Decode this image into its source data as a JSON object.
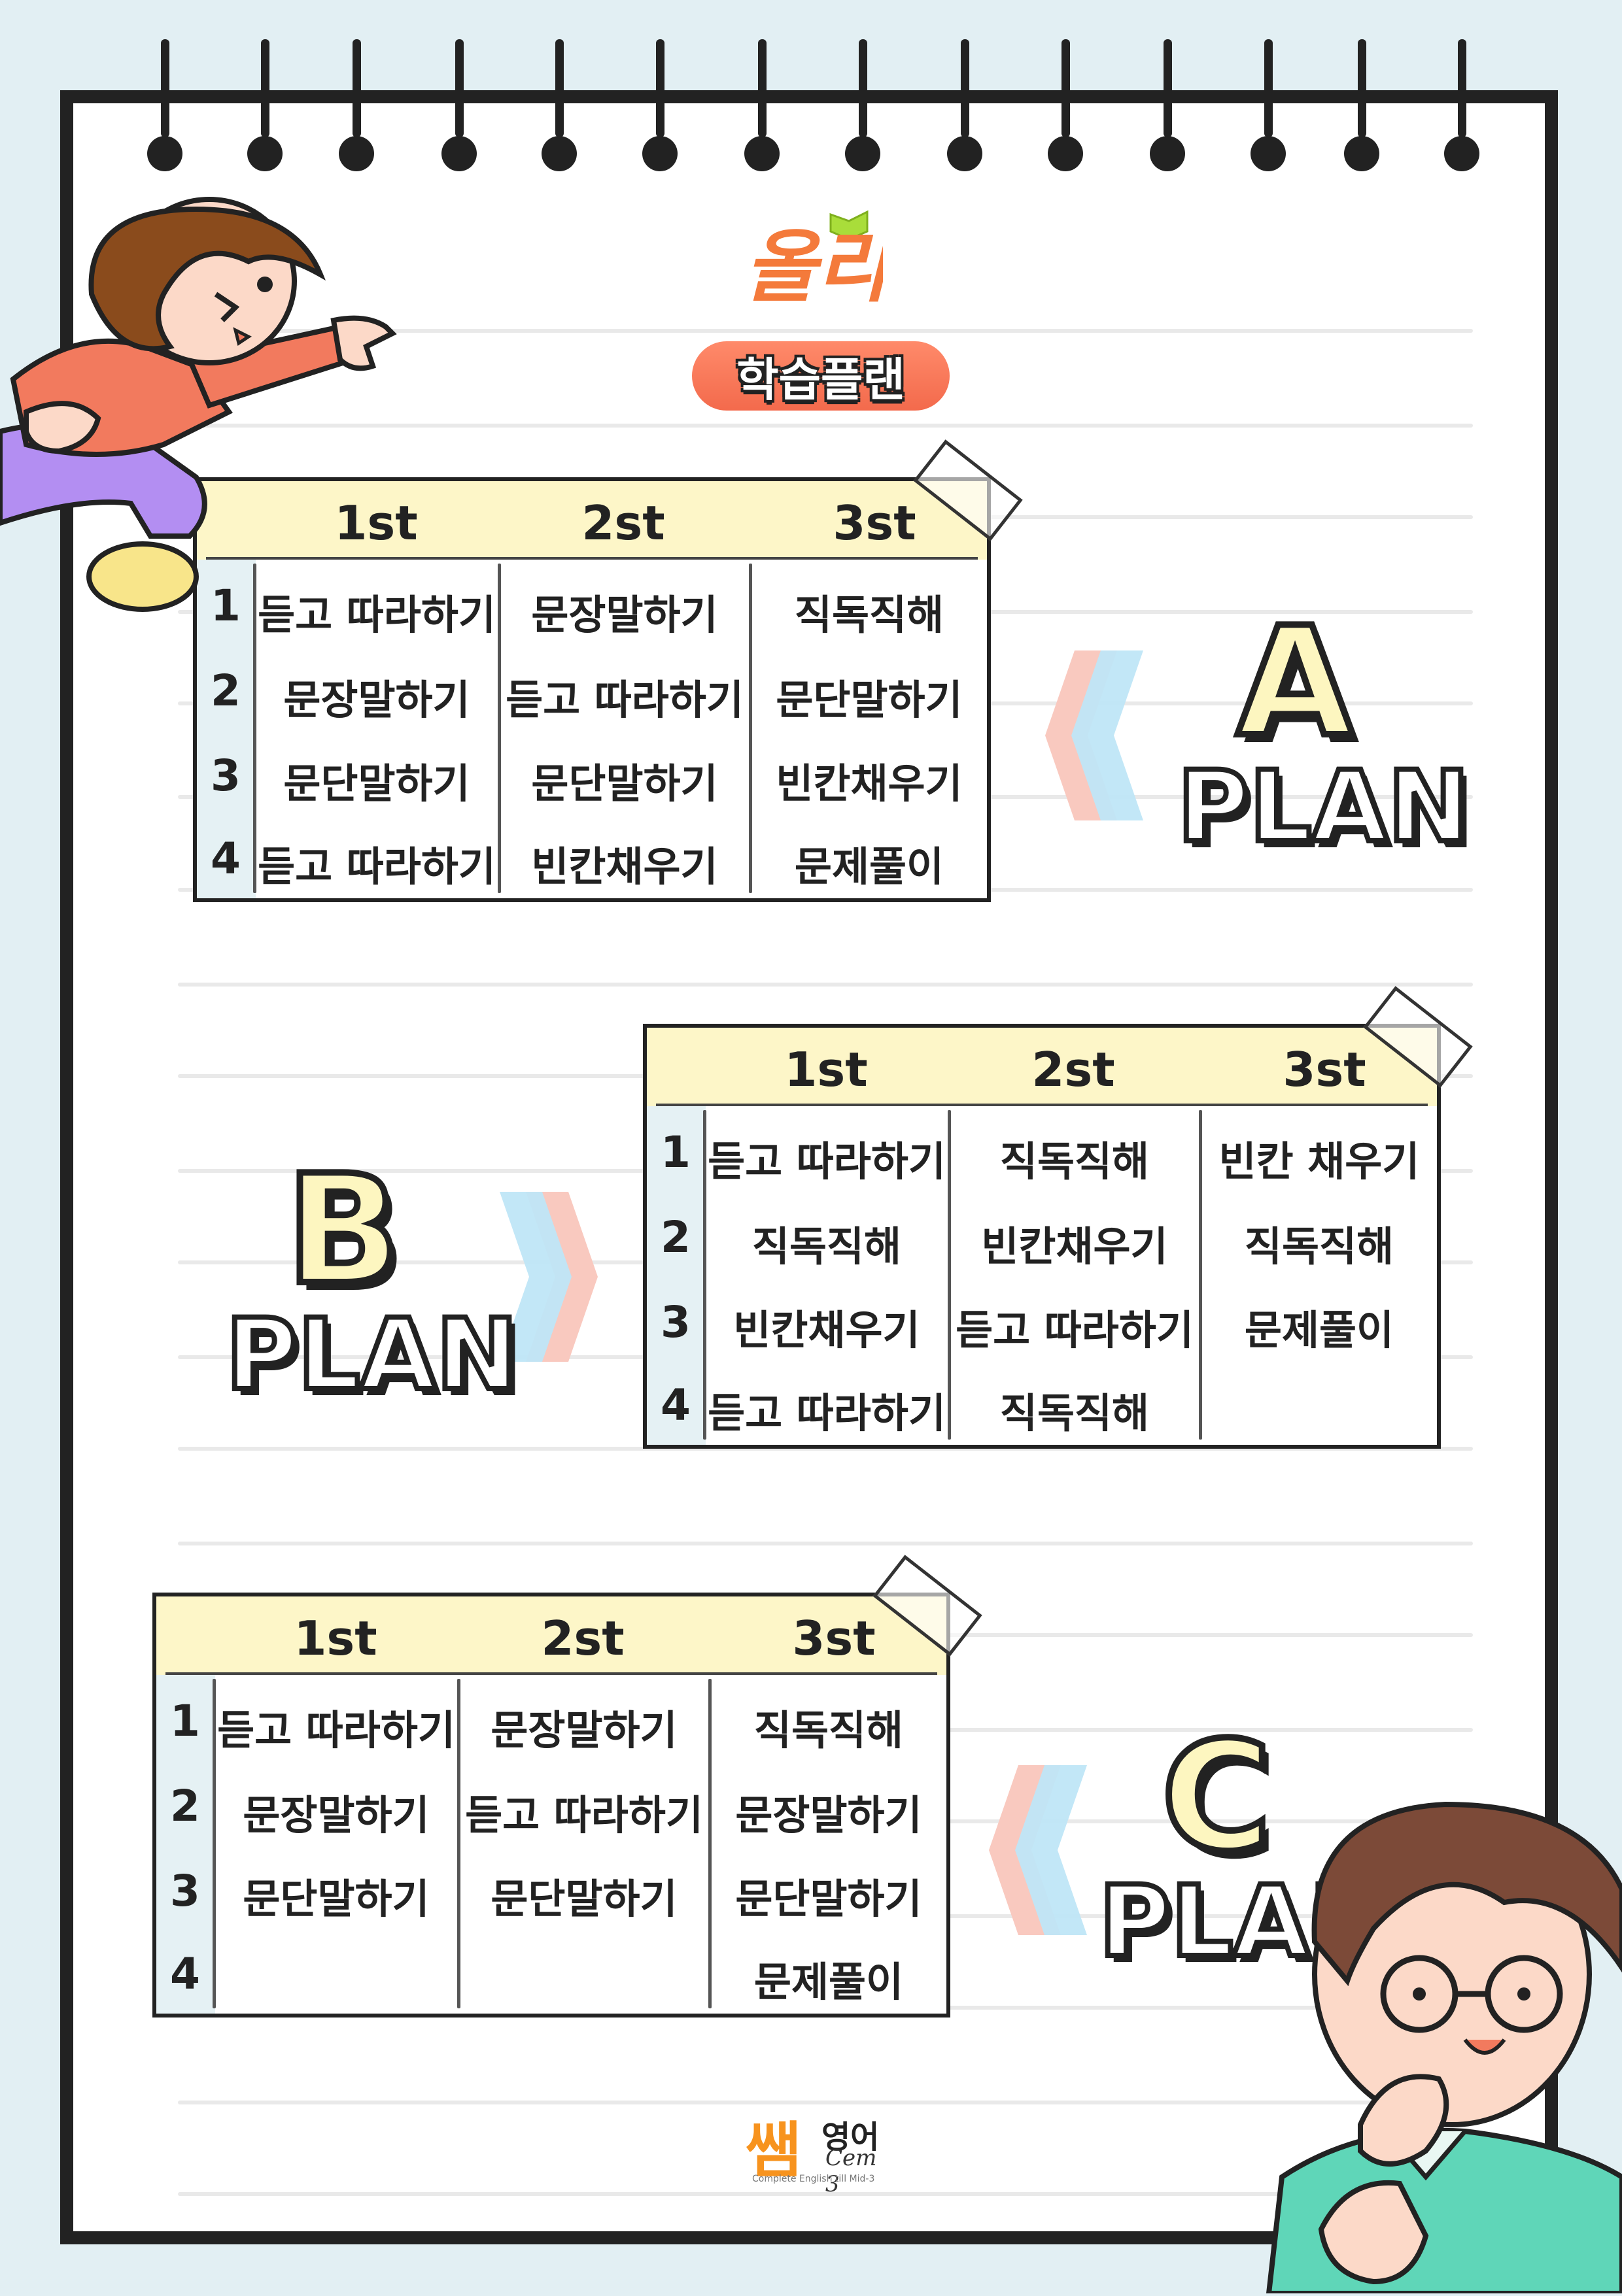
{
  "logo": {
    "text": "올리"
  },
  "badge": {
    "label": "학습플랜"
  },
  "plans": [
    {
      "letter": "A",
      "word": "PLAN",
      "headers": [
        "1st",
        "2st",
        "3st"
      ],
      "rows": [
        {
          "num": "1",
          "cells": [
            "듣고 따라하기",
            "문장말하기",
            "직독직해"
          ]
        },
        {
          "num": "2",
          "cells": [
            "문장말하기",
            "듣고 따라하기",
            "문단말하기"
          ]
        },
        {
          "num": "3",
          "cells": [
            "문단말하기",
            "문단말하기",
            "빈칸채우기"
          ]
        },
        {
          "num": "4",
          "cells": [
            "듣고 따라하기",
            "빈칸채우기",
            "문제풀이"
          ]
        }
      ]
    },
    {
      "letter": "B",
      "word": "PLAN",
      "headers": [
        "1st",
        "2st",
        "3st"
      ],
      "rows": [
        {
          "num": "1",
          "cells": [
            "듣고 따라하기",
            "직독직해",
            "빈칸 채우기"
          ]
        },
        {
          "num": "2",
          "cells": [
            "직독직해",
            "빈칸채우기",
            "직독직해"
          ]
        },
        {
          "num": "3",
          "cells": [
            "빈칸채우기",
            "듣고 따라하기",
            "문제풀이"
          ]
        },
        {
          "num": "4",
          "cells": [
            "듣고 따라하기",
            "직독직해",
            ""
          ]
        }
      ]
    },
    {
      "letter": "C",
      "word": "PLAN",
      "headers": [
        "1st",
        "2st",
        "3st"
      ],
      "rows": [
        {
          "num": "1",
          "cells": [
            "듣고 따라하기",
            "문장말하기",
            "직독직해"
          ]
        },
        {
          "num": "2",
          "cells": [
            "문장말하기",
            "듣고 따라하기",
            "문장말하기"
          ]
        },
        {
          "num": "3",
          "cells": [
            "문단말하기",
            "문단말하기",
            "문단말하기"
          ]
        },
        {
          "num": "4",
          "cells": [
            "",
            "",
            "문제풀이"
          ]
        }
      ]
    }
  ],
  "footer": {
    "brand_kr": "쌤",
    "brand_kr2": "영어",
    "brand_en": "Cem 3",
    "tagline": "Complete English till Mid-3"
  },
  "colors": {
    "header_yellow": "#fdf6c8",
    "number_blue": "#e5f1f4",
    "accent_orange": "#f36a4c",
    "chevron_pink": "#f9c9bf",
    "chevron_blue": "#bfe6f7"
  }
}
